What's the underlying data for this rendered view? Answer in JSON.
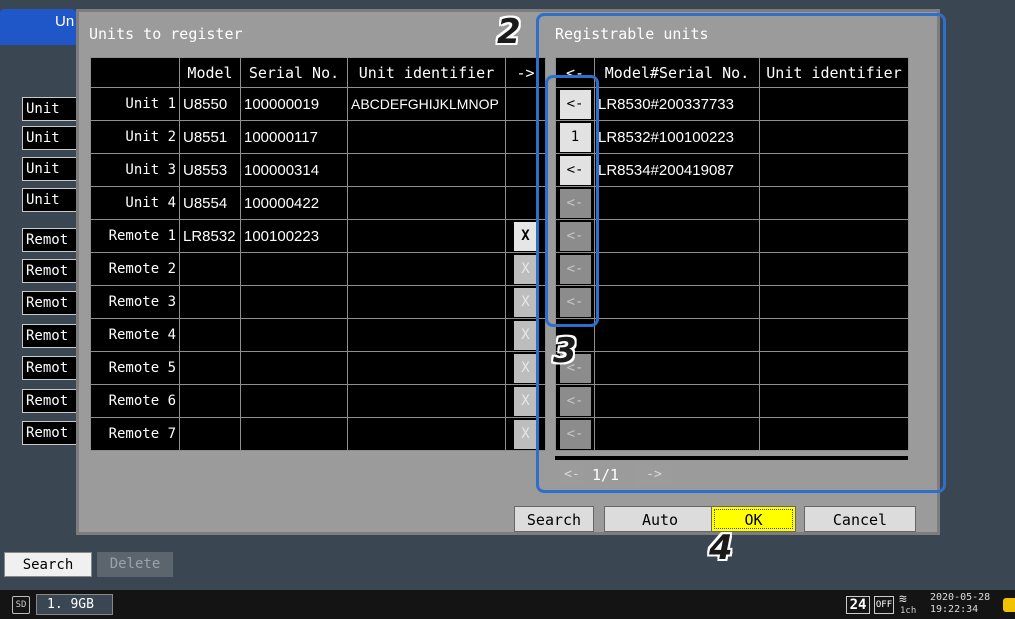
{
  "background": {
    "tab_label": "Un",
    "side_list": [
      "Unit",
      "Unit",
      "Unit",
      "Unit",
      "Remot",
      "Remot",
      "Remot",
      "Remot",
      "Remot",
      "Remot",
      "Remot"
    ],
    "search_label": "Search",
    "delete_label": "Delete",
    "storage": "1. 9GB",
    "status": {
      "badge": "24",
      "off": "OFF",
      "ch": "1ch",
      "date": "2020-05-28",
      "time": "19:22:34"
    }
  },
  "units_to_register": {
    "title": "Units to register",
    "headers": [
      "Model",
      "Serial No.",
      "Unit identifier",
      "->"
    ],
    "rows": [
      {
        "label": "Unit 1",
        "model": "U8550",
        "serial": "100000019",
        "identifier": "ABCDEFGHIJKLMNOP",
        "x_state": "none"
      },
      {
        "label": "Unit 2",
        "model": "U8551",
        "serial": "100000117",
        "identifier": "",
        "x_state": "none"
      },
      {
        "label": "Unit 3",
        "model": "U8553",
        "serial": "100000314",
        "identifier": "",
        "x_state": "none"
      },
      {
        "label": "Unit 4",
        "model": "U8554",
        "serial": "100000422",
        "identifier": "",
        "x_state": "none"
      },
      {
        "label": "Remote 1",
        "model": "LR8532",
        "serial": "100100223",
        "identifier": "",
        "x_state": "enabled"
      },
      {
        "label": "Remote 2",
        "model": "",
        "serial": "",
        "identifier": "",
        "x_state": "disabled"
      },
      {
        "label": "Remote 3",
        "model": "",
        "serial": "",
        "identifier": "",
        "x_state": "disabled"
      },
      {
        "label": "Remote 4",
        "model": "",
        "serial": "",
        "identifier": "",
        "x_state": "disabled"
      },
      {
        "label": "Remote 5",
        "model": "",
        "serial": "",
        "identifier": "",
        "x_state": "disabled"
      },
      {
        "label": "Remote 6",
        "model": "",
        "serial": "",
        "identifier": "",
        "x_state": "disabled"
      },
      {
        "label": "Remote 7",
        "model": "",
        "serial": "",
        "identifier": "",
        "x_state": "disabled"
      }
    ],
    "x_label": "X"
  },
  "registrable_units": {
    "title": "Registrable units",
    "headers": [
      "<-",
      "Model#Serial No.",
      "Unit identifier"
    ],
    "rows": [
      {
        "action": "<-",
        "active": true,
        "model_serial": "LR8530#200337733",
        "identifier": ""
      },
      {
        "action": "1",
        "active": true,
        "model_serial": "LR8532#100100223",
        "identifier": ""
      },
      {
        "action": "<-",
        "active": true,
        "model_serial": "LR8534#200419087",
        "identifier": ""
      },
      {
        "action": "<-",
        "active": false,
        "model_serial": "",
        "identifier": ""
      },
      {
        "action": "<-",
        "active": false,
        "model_serial": "",
        "identifier": ""
      },
      {
        "action": "<-",
        "active": false,
        "model_serial": "",
        "identifier": ""
      },
      {
        "action": "<-",
        "active": false,
        "model_serial": "",
        "identifier": ""
      },
      {
        "action": "",
        "active": false,
        "model_serial": "",
        "identifier": ""
      },
      {
        "action": "<-",
        "active": false,
        "model_serial": "",
        "identifier": ""
      },
      {
        "action": "<-",
        "active": false,
        "model_serial": "",
        "identifier": ""
      },
      {
        "action": "<-",
        "active": false,
        "model_serial": "",
        "identifier": ""
      }
    ],
    "pager": {
      "prev": "<-",
      "page": "1/1",
      "next": "->"
    }
  },
  "buttons": {
    "search": "Search",
    "auto": "Auto",
    "ok": "OK",
    "cancel": "Cancel"
  },
  "callouts": {
    "n2": "2",
    "n3": "3",
    "n4": "4"
  },
  "colors": {
    "ok_button": "#ffff00",
    "callout_border": "#2f6fcc",
    "selected_tab": "#1f57c8"
  }
}
